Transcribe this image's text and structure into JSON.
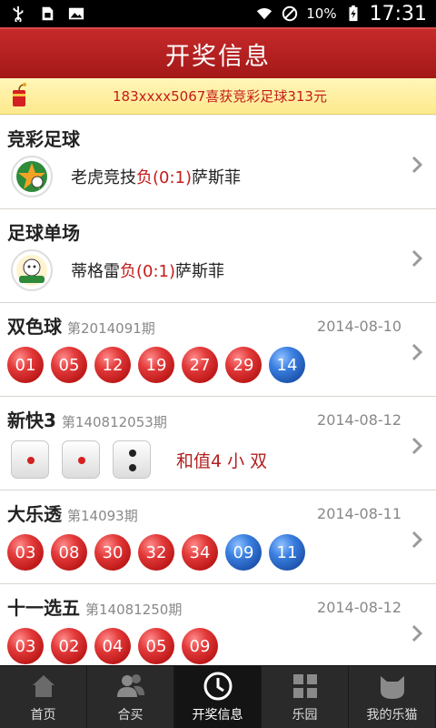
{
  "status": {
    "battery_pct": "10%",
    "time": "17:31"
  },
  "title": "开奖信息",
  "notice": "183xxxx5067喜获竞彩足球313元",
  "games": [
    {
      "name": "竞彩足球",
      "match_home": "老虎竞技",
      "result": "负(0:1)",
      "match_away": "萨斯菲"
    },
    {
      "name": "足球单场",
      "match_home": "蒂格雷",
      "result": "负(0:1)",
      "match_away": "萨斯菲"
    }
  ],
  "ssq": {
    "name": "双色球",
    "issue": "第2014091期",
    "date": "2014-08-10",
    "balls": [
      {
        "n": "01",
        "c": "red"
      },
      {
        "n": "05",
        "c": "red"
      },
      {
        "n": "12",
        "c": "red"
      },
      {
        "n": "19",
        "c": "red"
      },
      {
        "n": "27",
        "c": "red"
      },
      {
        "n": "29",
        "c": "red"
      },
      {
        "n": "14",
        "c": "blue"
      }
    ]
  },
  "k3": {
    "name": "新快3",
    "issue": "第140812053期",
    "date": "2014-08-12",
    "dice": [
      1,
      1,
      2
    ],
    "sum_text": "和值4 小 双"
  },
  "dlt": {
    "name": "大乐透",
    "issue": "第14093期",
    "date": "2014-08-11",
    "balls": [
      {
        "n": "03",
        "c": "red"
      },
      {
        "n": "08",
        "c": "red"
      },
      {
        "n": "30",
        "c": "red"
      },
      {
        "n": "32",
        "c": "red"
      },
      {
        "n": "34",
        "c": "red"
      },
      {
        "n": "09",
        "c": "blue"
      },
      {
        "n": "11",
        "c": "blue"
      }
    ]
  },
  "syxw": {
    "name": "十一选五",
    "issue": "第14081250期",
    "date": "2014-08-12",
    "balls": [
      {
        "n": "03",
        "c": "red"
      },
      {
        "n": "02",
        "c": "red"
      },
      {
        "n": "04",
        "c": "red"
      },
      {
        "n": "05",
        "c": "red"
      },
      {
        "n": "09",
        "c": "red"
      }
    ]
  },
  "tabs": [
    {
      "label": "首页",
      "icon": "home-icon"
    },
    {
      "label": "合买",
      "icon": "group-icon"
    },
    {
      "label": "开奖信息",
      "icon": "clock-icon",
      "active": true
    },
    {
      "label": "乐园",
      "icon": "grid-icon"
    },
    {
      "label": "我的乐猫",
      "icon": "cat-icon"
    }
  ],
  "colors": {
    "brand_red": "#b51f1f",
    "result_red": "#c41c1c",
    "ball_red": "#e33a3a",
    "ball_blue": "#3a7fe0"
  }
}
